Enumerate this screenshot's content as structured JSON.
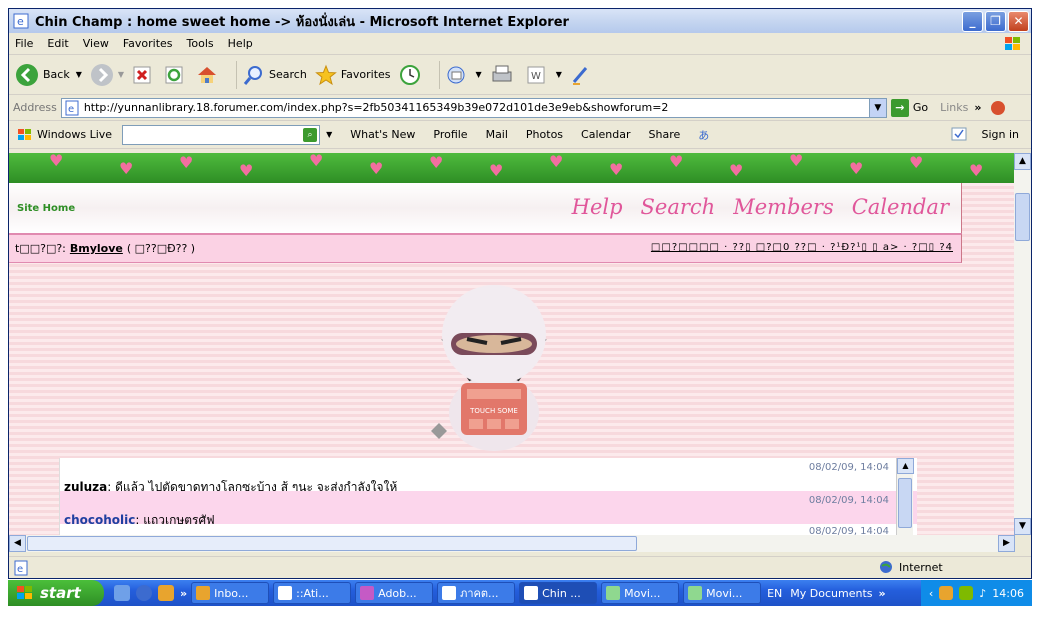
{
  "window": {
    "title": "Chin Champ : home sweet home -> ห้องนั่งเล่น - Microsoft Internet Explorer",
    "buttons": [
      "_",
      "❐",
      "✕"
    ]
  },
  "menu": [
    "File",
    "Edit",
    "View",
    "Favorites",
    "Tools",
    "Help"
  ],
  "toolbar": {
    "back": "Back",
    "search": "Search",
    "favorites": "Favorites"
  },
  "address": {
    "label": "Address",
    "url": "http://yunnanlibrary.18.forumer.com/index.php?s=2fb50341165349b39e072d101de3e9eb&showforum=2",
    "go": "Go",
    "links": "Links"
  },
  "live": {
    "brand": "Windows Live",
    "links": [
      "What's New",
      "Profile",
      "Mail",
      "Photos",
      "Calendar",
      "Share"
    ],
    "sign_in": "Sign in"
  },
  "forum": {
    "site_home": "Site Home",
    "nav": [
      "Help",
      "Search",
      "Members",
      "Calendar"
    ],
    "logged_prefix": "t□□?□?:",
    "username": "Bmylove",
    "logged_suffix": "( □??□Đ?? )",
    "right_links": "□□?□□□□ · ??▯ □?□0 ??□ · ?¹Đ?¹▯ ▯ a> · ?□▯ ?4"
  },
  "shoutbox": {
    "messages": [
      {
        "user": "zuluza",
        "text": ": ดีแล้ว ไปตัดขาดทางโลกซะบ้าง สู้ ๆนะ จะส่งกำลังใจให้",
        "time": "08/02/09, 14:04"
      },
      {
        "user": "chocoholic",
        "text": ": แถวเกษตรศัฟ",
        "time": "08/02/09, 14:04"
      }
    ],
    "next_time": "08/02/09, 14:04"
  },
  "ninja": {
    "device_text": "TOUCH SOME"
  },
  "status": {
    "zone": "Internet"
  },
  "taskbar": {
    "start": "start",
    "tasks": [
      "Inbo...",
      "::Ati...",
      "Adob...",
      "ภาคต...",
      "Chin ...",
      "Movi...",
      "Movi..."
    ],
    "lang": "EN",
    "folder": "My Documents",
    "clock": "14:06"
  },
  "colors": {
    "accent_pink": "#E0569A",
    "title_bar": "#C2D3EF",
    "taskbar_blue": "#245EDC"
  }
}
